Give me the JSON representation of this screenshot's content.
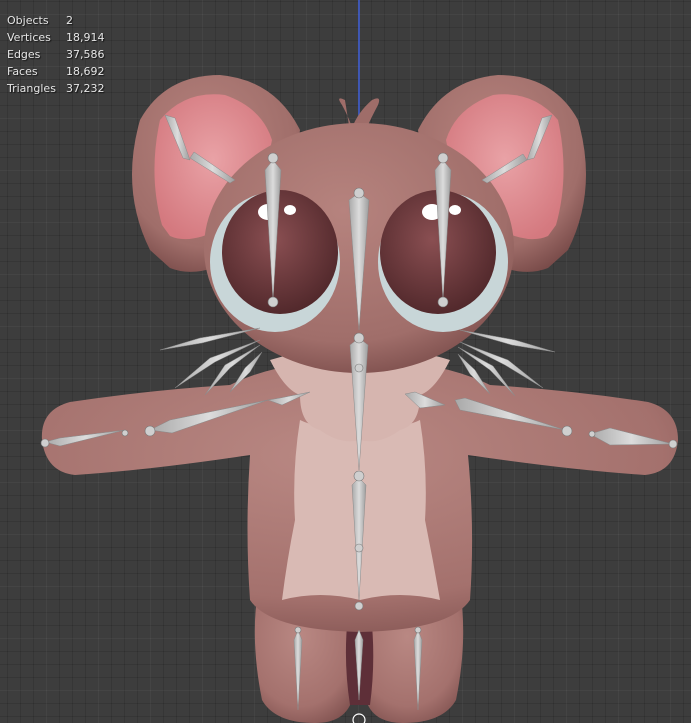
{
  "viewport": {
    "background": "#3d3d3d",
    "axis_color": "#3f5ed8"
  },
  "stats": [
    {
      "label": "Objects",
      "value": "2"
    },
    {
      "label": "Vertices",
      "value": "18,914"
    },
    {
      "label": "Edges",
      "value": "37,586"
    },
    {
      "label": "Faces",
      "value": "18,692"
    },
    {
      "label": "Triangles",
      "value": "37,232"
    }
  ],
  "model": {
    "body_color": "#a87672",
    "inner_ear_color": "#e2959a",
    "belly_color": "#dcbdb7",
    "eye_color": "#6e3a3d",
    "bone_color": "#c9c9c9"
  }
}
